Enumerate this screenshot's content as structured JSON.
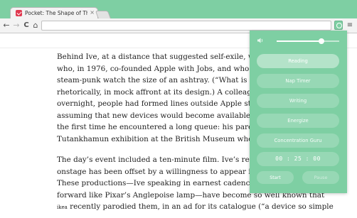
{
  "browser": {
    "tab": {
      "title": "Pocket: The Shape of Thin",
      "close_icon": "×"
    },
    "toolbar": {
      "back_icon": "←",
      "forward_icon": "→",
      "reload_icon": "C",
      "home_icon": "⌂",
      "menu_icon": "≡",
      "address_value": ""
    }
  },
  "article": {
    "paragraph1": [
      "Behind Ive, at a distance that suggested self-exile, was Stev",
      "who, in 1976, co-founded Apple with Jobs, and who was wa",
      "steam-punk watch the size of an ashtray. (“What is that?” I",
      "rhetorically, in mock affront at its design.) A colleague told",
      "overnight, people had formed lines outside Apple stores, w",
      "assuming that new devices would become available that da",
      "the first time he encountered a long queue: his parents too",
      "Tutankhamun exhibition at the British Museum when he w"
    ],
    "paragraph2": [
      "The day’s event included a ten-minute film. Ive’s reluctanc",
      "onstage has been offset by a willingness to appear in script",
      "These productions—Ive speaking in earnest cadences, his",
      "forward like Pixar’s Anglepoise lamp—have become so well known that"
    ],
    "last_line_small": "ikea",
    "last_line_rest": " recently parodied them, in an ad for its catalogue (“a device so simple"
  },
  "popup": {
    "volume_level": 0.72,
    "modes": [
      {
        "label": "Reading",
        "active": true
      },
      {
        "label": "Nap Timer",
        "active": false
      },
      {
        "label": "Writing",
        "active": false
      },
      {
        "label": "Energize",
        "active": false
      },
      {
        "label": "Concentration Guru",
        "active": false
      }
    ],
    "timer": {
      "minutes": "25",
      "seconds": "00",
      "prefix": "00",
      "display": "00 : 25 : 00"
    },
    "start_label": "Start",
    "pause_label": "Pause"
  },
  "colors": {
    "accent": "#7ecfa3",
    "toolbar": "#f3f3f3"
  }
}
